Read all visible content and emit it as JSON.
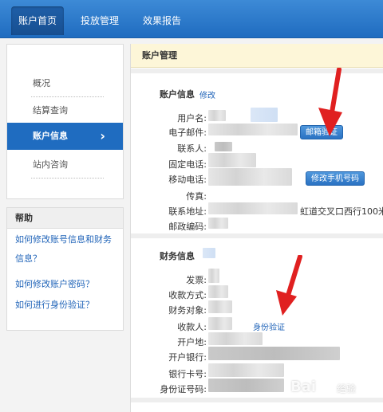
{
  "nav": {
    "tabs": [
      {
        "label": "账户首页",
        "active": true
      },
      {
        "label": "投放管理",
        "active": false
      },
      {
        "label": "效果报告",
        "active": false
      }
    ]
  },
  "sidebar": {
    "items": [
      {
        "label": "概况",
        "active": false
      },
      {
        "label": "结算查询",
        "active": false
      },
      {
        "label": "账户信息",
        "active": true
      },
      {
        "label": "站内咨询",
        "active": false
      }
    ],
    "active_chevron": "›"
  },
  "help": {
    "title": "帮助",
    "links": [
      "如何修改账号信息和财务信息？",
      "如何修改账户密码？",
      "如何进行身份验证？"
    ]
  },
  "main": {
    "header": "账户管理",
    "account_section": {
      "title": "账户信息",
      "edit_link": "修改",
      "labels": {
        "username": "用户名:",
        "email": "电子邮件:",
        "contact": "联系人:",
        "landline": "固定电话:",
        "mobile": "移动电话:",
        "fax": "传真:",
        "address": "联系地址:",
        "postcode": "邮政编码:"
      },
      "verify_email_button": "邮箱验证",
      "change_mobile_button": "修改手机号码",
      "address_visible_text": "虹道交叉口西行100米"
    },
    "finance_section": {
      "title": "财务信息",
      "labels": {
        "invoice": "发票:",
        "payment_method": "收款方式:",
        "finance_target": "财务对象:",
        "payee": "收款人:",
        "bank_location": "开户地:",
        "bank": "开户银行:",
        "card_number": "银行卡号:",
        "id_number": "身份证号码:"
      },
      "verify_identity_link": "身份验证"
    }
  },
  "watermark": {
    "brand": "Bai",
    "suffix": "经验"
  },
  "colors": {
    "nav_blue": "#1f6cc0",
    "link_blue": "#1f63b8",
    "arrow_red": "#e02020",
    "header_bg": "#fdf6d8"
  }
}
